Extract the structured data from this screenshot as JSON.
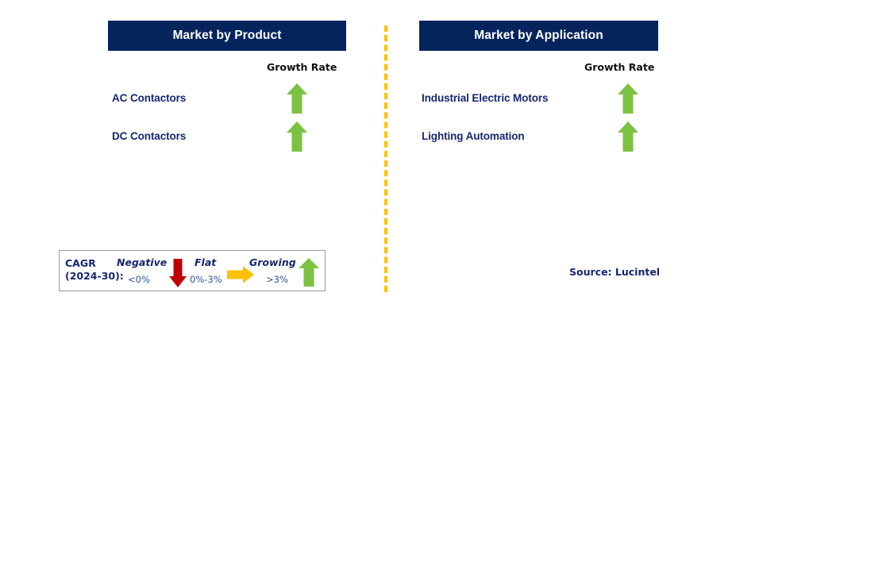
{
  "panels": [
    {
      "id": "market-by-product",
      "title": "Market by Product",
      "growth_rate_label": "Growth Rate",
      "rows": [
        {
          "label": "AC Contactors",
          "growth": "growing",
          "icon": "arrow-up-icon"
        },
        {
          "label": "DC Contactors",
          "growth": "growing",
          "icon": "arrow-up-icon"
        }
      ]
    },
    {
      "id": "market-by-application",
      "title": "Market by Application",
      "growth_rate_label": "Growth Rate",
      "rows": [
        {
          "label": "Industrial Electric Motors",
          "growth": "growing",
          "icon": "arrow-up-icon"
        },
        {
          "label": "Lighting Automation",
          "growth": "growing",
          "icon": "arrow-up-icon"
        }
      ]
    }
  ],
  "legend": {
    "title_line1": "CAGR",
    "title_line2": "(2024-30):",
    "entries": [
      {
        "term": "Negative",
        "range": "<0%",
        "icon": "arrow-down-icon",
        "color": "#c00000"
      },
      {
        "term": "Flat",
        "range": "0%-3%",
        "icon": "arrow-right-icon",
        "color": "#ffc000"
      },
      {
        "term": "Growing",
        "range": ">3%",
        "icon": "arrow-up-icon",
        "color": "#7cc242"
      }
    ]
  },
  "source": {
    "text": "Source: Lucintel"
  },
  "colors": {
    "header_navy": "#06245c",
    "text_navy": "#17276e",
    "growth_green": "#7cc242",
    "negative_red": "#c00000",
    "flat_orange": "#ffc000",
    "divider_orange": "#ffc000",
    "legend_border": "#9b9b9b"
  }
}
